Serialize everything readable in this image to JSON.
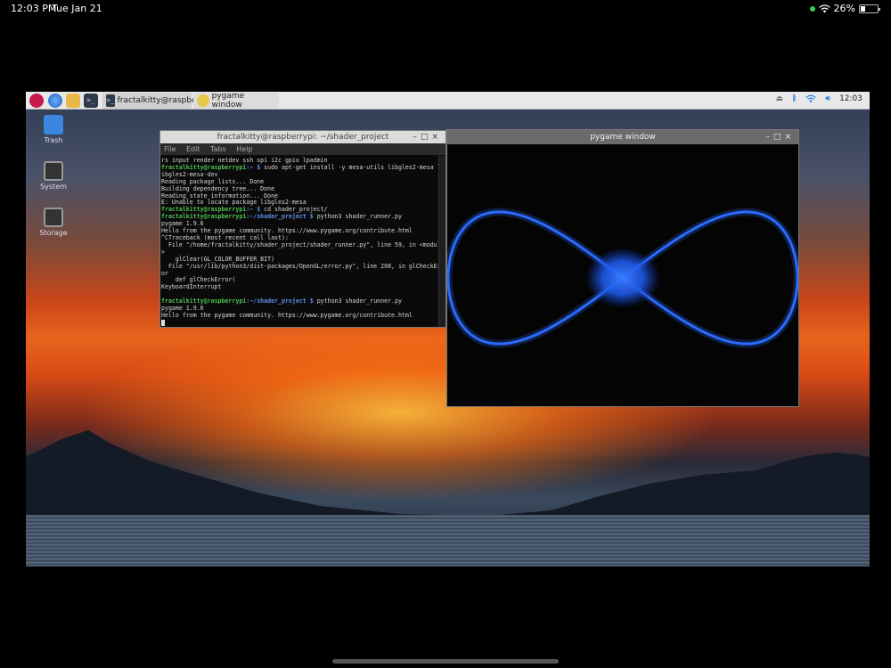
{
  "ipad": {
    "time": "12:03 PM",
    "date": "Tue Jan 21",
    "battery_percent": "26%",
    "battery_level": 0.26
  },
  "taskbar": {
    "terminal_task_label": "fractalkitty@raspberr...",
    "pygame_task_label": "pygame window",
    "clock": "12:03"
  },
  "desktop_icons": {
    "trash": "Trash",
    "system": "System",
    "storage": "Storage"
  },
  "terminal": {
    "title": "fractalkitty@raspberrypi: ~/shader_project",
    "menu": {
      "file": "File",
      "edit": "Edit",
      "tabs": "Tabs",
      "help": "Help"
    },
    "lines": [
      {
        "text": "rs input render netdev ssh spi i2c gpio lpadmin"
      },
      {
        "user": "fractalkitty@raspberrypi",
        "path": ":~ $",
        "text": " sudo apt-get install -y mesa-utils libgles2-mesa l"
      },
      {
        "text": "ibgles2-mesa-dev"
      },
      {
        "text": "Reading package lists... Done"
      },
      {
        "text": "Building dependency tree... Done"
      },
      {
        "text": "Reading state information... Done"
      },
      {
        "text": "E: Unable to locate package libgles2-mesa"
      },
      {
        "user": "fractalkitty@raspberrypi",
        "path": ":~ $",
        "text": " cd shader_project/"
      },
      {
        "user": "fractalkitty@raspberrypi",
        "path": ":~/shader_project $",
        "text": " python3 shader_runner.py"
      },
      {
        "text": "pygame 1.9.6"
      },
      {
        "text": "Hello from the pygame community. https://www.pygame.org/contribute.html"
      },
      {
        "text": "^CTraceback (most recent call last):"
      },
      {
        "text": "  File \"/home/fractalkitty/shader_project/shader_runner.py\", line 59, in <module"
      },
      {
        "text": ">"
      },
      {
        "text": "    glClear(GL_COLOR_BUFFER_BIT)"
      },
      {
        "text": "  File \"/usr/lib/python3/dist-packages/OpenGL/error.py\", line 208, in glCheckErr"
      },
      {
        "text": "or"
      },
      {
        "text": "    def glCheckError("
      },
      {
        "text": "KeyboardInterrupt"
      },
      {
        "text": ""
      },
      {
        "user": "fractalkitty@raspberrypi",
        "path": ":~/shader_project $",
        "text": " python3 shader_runner.py"
      },
      {
        "text": "pygame 1.9.6"
      },
      {
        "text": "Hello from the pygame community. https://www.pygame.org/contribute.html"
      }
    ]
  },
  "pygame": {
    "title": "pygame window"
  },
  "colors": {
    "prompt_user": "#4fc14f",
    "prompt_path": "#5b8fe8",
    "shader_blue": "#2a6bff"
  }
}
